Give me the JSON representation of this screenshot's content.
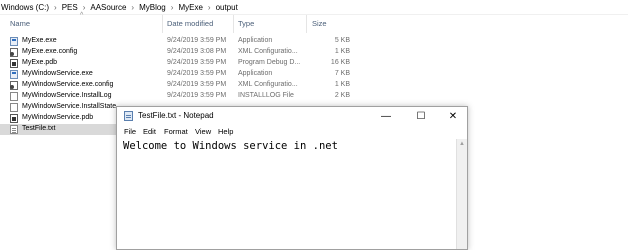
{
  "breadcrumb": [
    "Windows (C:)",
    "PES",
    "AASource",
    "MyBlog",
    "MyExe",
    "output"
  ],
  "columns": {
    "name": "Name",
    "date": "Date modified",
    "type": "Type",
    "size": "Size"
  },
  "files": [
    {
      "name": "MyExe.exe",
      "date": "9/24/2019 3:59 PM",
      "type": "Application",
      "size": "5 KB",
      "icon": "exe-icon"
    },
    {
      "name": "MyExe.exe.config",
      "date": "9/24/2019 3:08 PM",
      "type": "XML Configuratio...",
      "size": "1 KB",
      "icon": "config-icon"
    },
    {
      "name": "MyExe.pdb",
      "date": "9/24/2019 3:59 PM",
      "type": "Program Debug D...",
      "size": "16 KB",
      "icon": "pdb-icon"
    },
    {
      "name": "MyWindowService.exe",
      "date": "9/24/2019 3:59 PM",
      "type": "Application",
      "size": "7 KB",
      "icon": "exe-icon"
    },
    {
      "name": "MyWindowService.exe.config",
      "date": "9/24/2019 3:59 PM",
      "type": "XML Configuratio...",
      "size": "1 KB",
      "icon": "config-icon"
    },
    {
      "name": "MyWindowService.InstallLog",
      "date": "9/24/2019 3:59 PM",
      "type": "INSTALLLOG File",
      "size": "2 KB",
      "icon": "log-icon"
    },
    {
      "name": "MyWindowService.InstallState",
      "date": "",
      "type": "",
      "size": "",
      "icon": "log-icon"
    },
    {
      "name": "MyWindowService.pdb",
      "date": "",
      "type": "",
      "size": "",
      "icon": "pdb-icon"
    },
    {
      "name": "TestFile.txt",
      "date": "",
      "type": "",
      "size": "",
      "icon": "txt-icon",
      "selected": true
    }
  ],
  "notepad": {
    "title": "TestFile.txt - Notepad",
    "controls": {
      "minimize": "—",
      "maximize": "☐",
      "close": "✕"
    },
    "menu": [
      "File",
      "Edit",
      "Format",
      "View",
      "Help"
    ],
    "content": "Welcome to Windows service in .net"
  }
}
